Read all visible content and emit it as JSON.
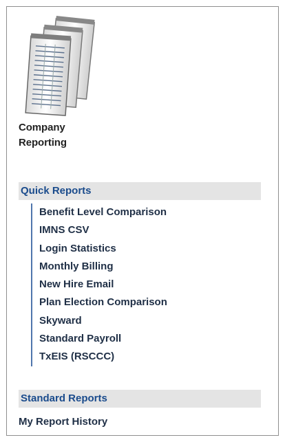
{
  "app": {
    "title_line1": "Company",
    "title_line2": "Reporting",
    "icon": "stacked-reports-icon"
  },
  "quick_reports": {
    "header": "Quick Reports",
    "items": [
      {
        "label": "Benefit Level Comparison"
      },
      {
        "label": "IMNS CSV"
      },
      {
        "label": "Login Statistics"
      },
      {
        "label": "Monthly Billing"
      },
      {
        "label": "New Hire Email"
      },
      {
        "label": "Plan Election Comparison"
      },
      {
        "label": "Skyward"
      },
      {
        "label": "Standard Payroll"
      },
      {
        "label": "TxEIS (RSCCC)"
      }
    ]
  },
  "standard_reports": {
    "header": "Standard Reports"
  },
  "history": {
    "label": "My Report History"
  },
  "colors": {
    "section_bg": "#e4e4e4",
    "section_text": "#1a4b8c",
    "list_border": "#4f75ac",
    "link_text": "#1f2f46"
  }
}
